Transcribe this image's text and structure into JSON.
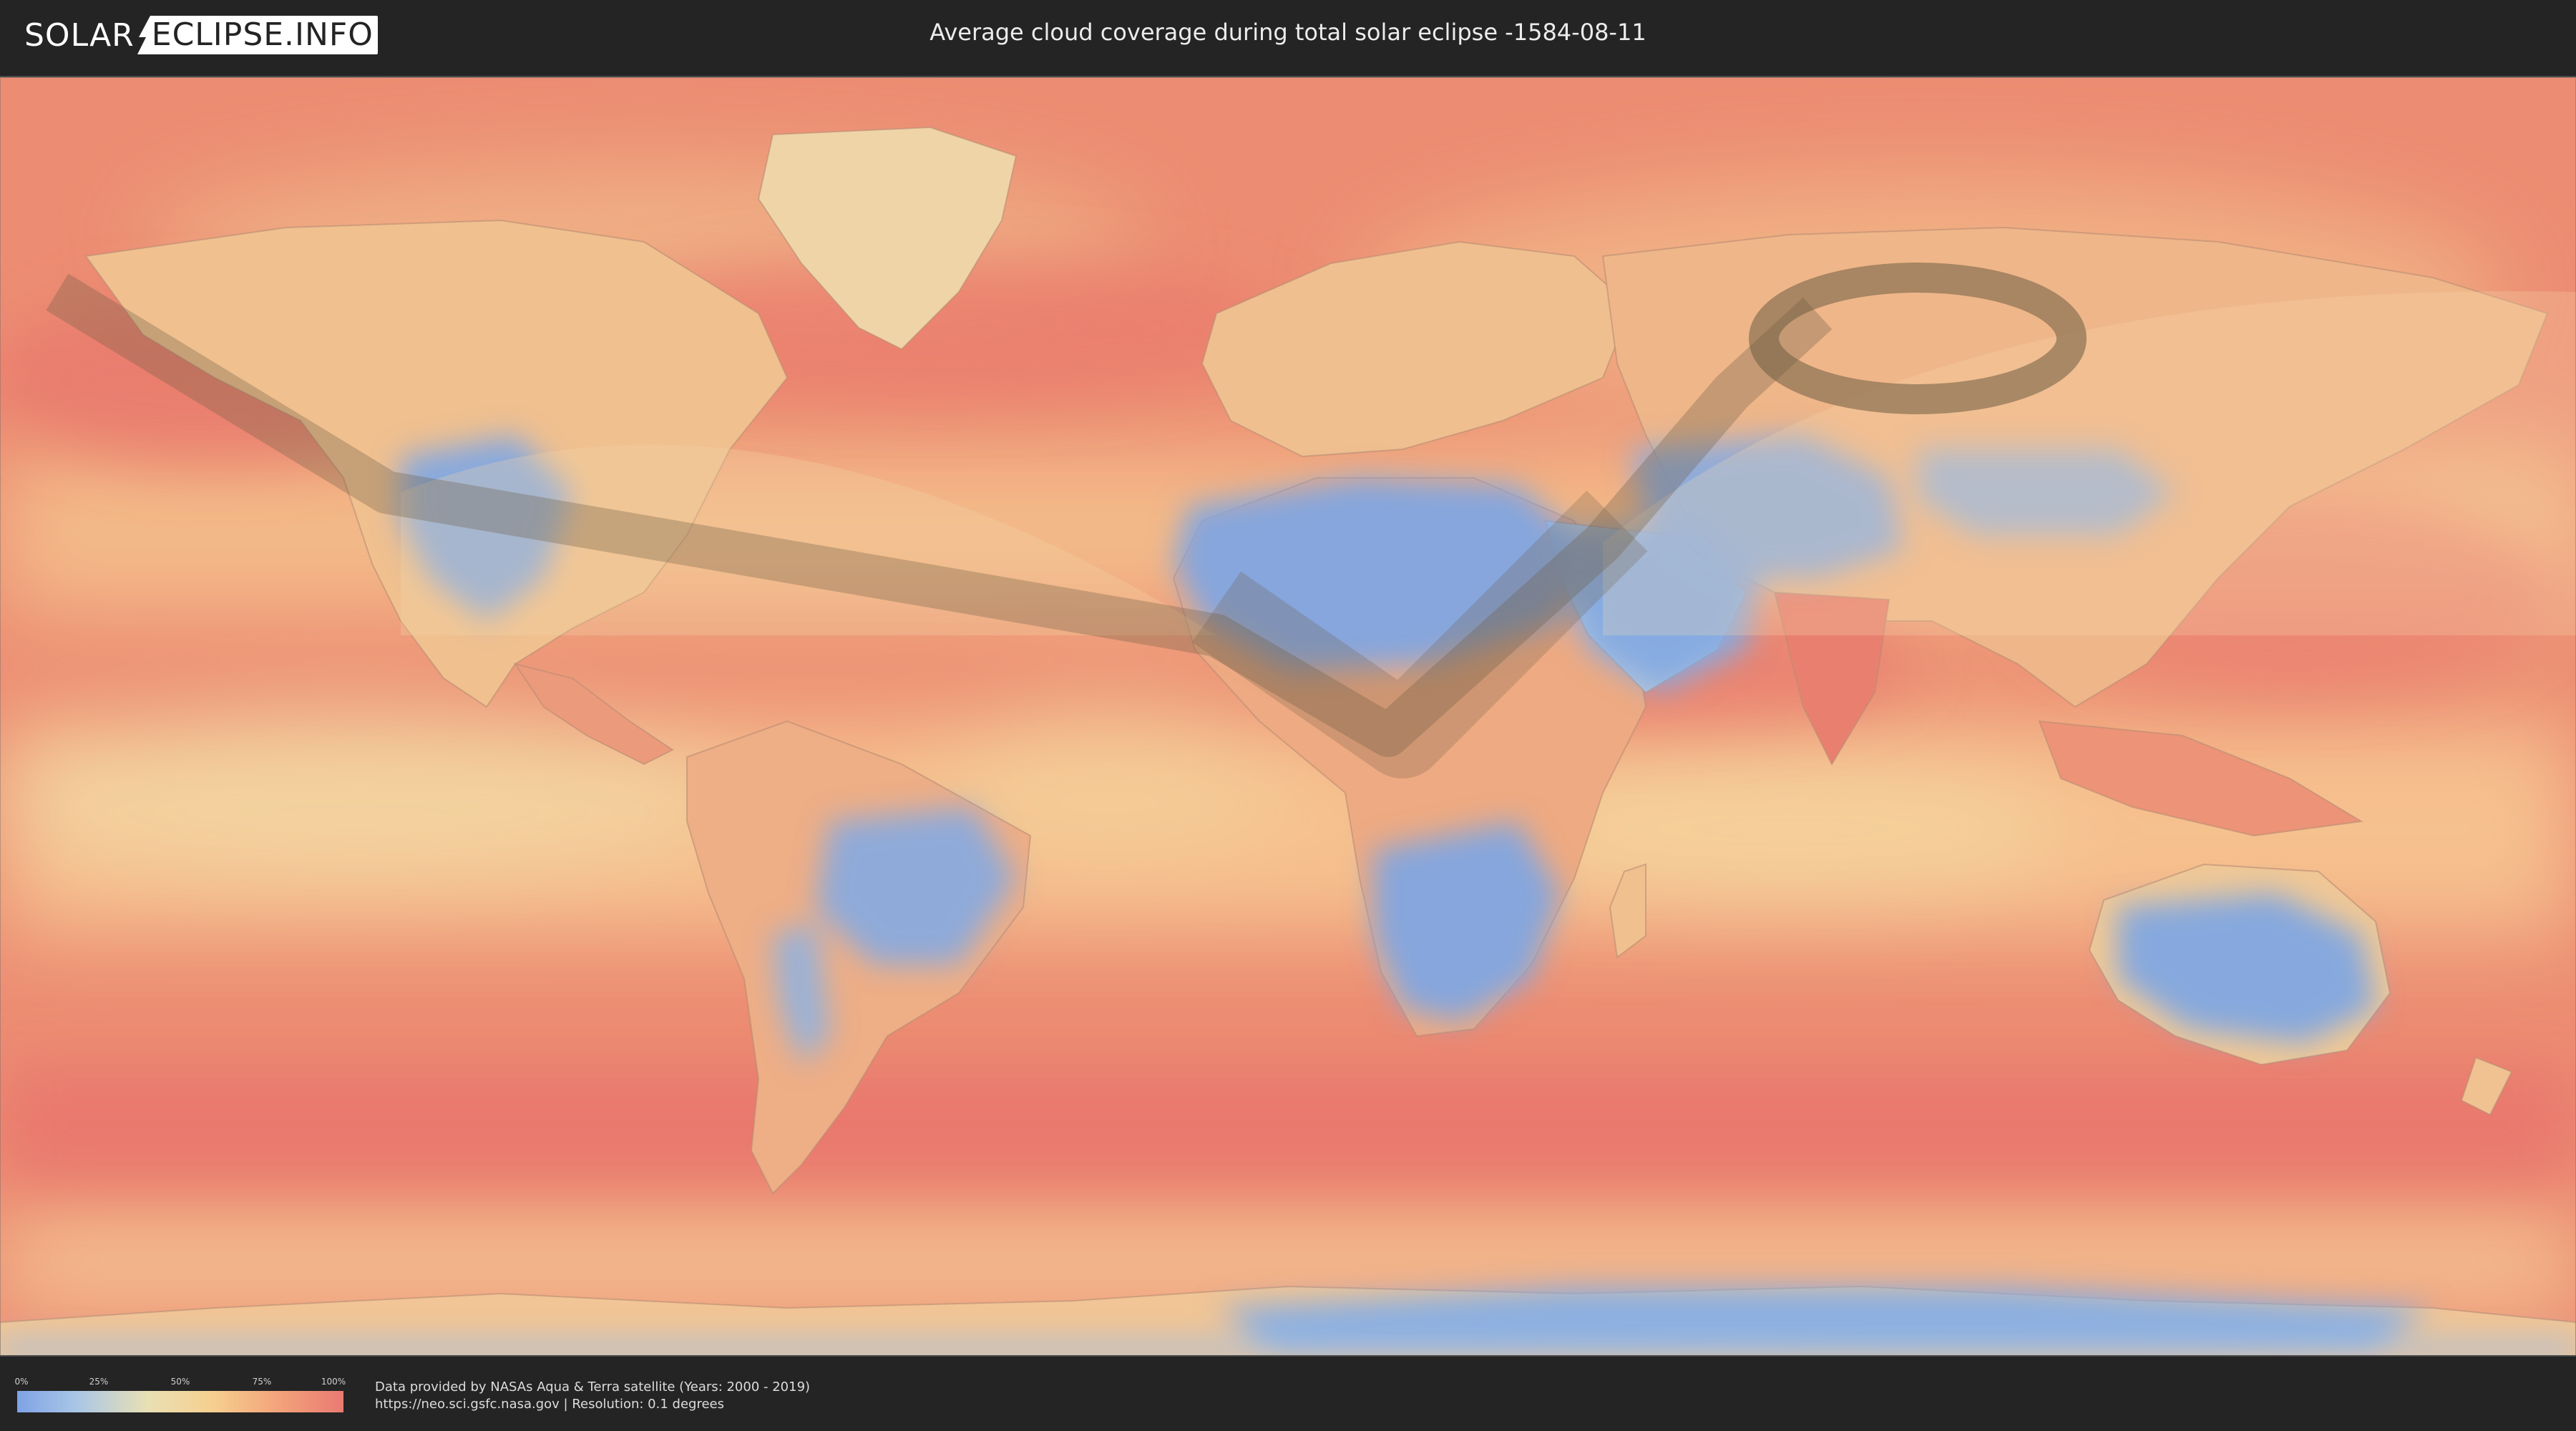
{
  "header": {
    "logo_left": "SOLAR",
    "logo_right": "ECLIPSE.INFO",
    "title": "Average cloud coverage during total solar eclipse -1584-08-11"
  },
  "legend": {
    "ticks": [
      "0%",
      "25%",
      "50%",
      "75%",
      "100%"
    ],
    "tick_values": [
      0,
      25,
      50,
      75,
      100
    ],
    "colors": [
      "#7ea3e6",
      "#a9c6e6",
      "#e9e0b4",
      "#f6cf8f",
      "#f3a37a",
      "#e97a72"
    ]
  },
  "credits": {
    "line1": "Data provided by NASAs Aqua & Terra satellite (Years: 2000 - 2019)",
    "line2": "https://neo.sci.gsfc.nasa.gov | Resolution: 0.1 degrees"
  },
  "map": {
    "projection": "equirectangular",
    "base_color": "#e88a6f",
    "clear_color": "#7fa6e2",
    "mid_color": "#f4cf92",
    "shadow_color": "#6e5c43"
  }
}
